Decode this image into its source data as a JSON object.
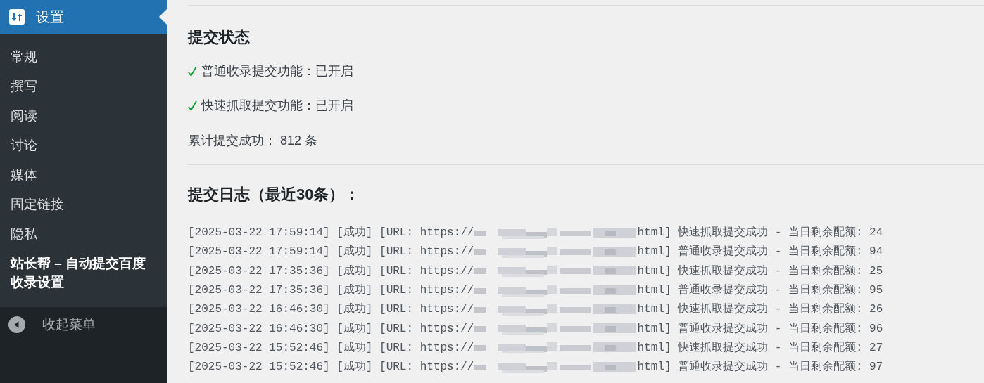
{
  "sidebar": {
    "header": {
      "label": "设置"
    },
    "items": [
      {
        "label": "常规",
        "selected": false
      },
      {
        "label": "撰写",
        "selected": false
      },
      {
        "label": "阅读",
        "selected": false
      },
      {
        "label": "讨论",
        "selected": false
      },
      {
        "label": "媒体",
        "selected": false
      },
      {
        "label": "固定链接",
        "selected": false
      },
      {
        "label": "隐私",
        "selected": false
      },
      {
        "label": "站长帮 – 自动提交百度收录设置",
        "selected": true
      }
    ],
    "collapse_label": "收起菜单"
  },
  "status": {
    "title": "提交状态",
    "features": [
      {
        "label": "普通收录提交功能：已开启"
      },
      {
        "label": "快速抓取提交功能：已开启"
      }
    ],
    "total": "累计提交成功： 812 条"
  },
  "log": {
    "title": "提交日志（最近30条）：",
    "entries": [
      {
        "before": "[2025-03-22 17:59:14] [成功] [URL: https://",
        "after": "html] 快速抓取提交成功 - 当日剩余配额: 24"
      },
      {
        "before": "[2025-03-22 17:59:14] [成功] [URL: https://",
        "after": "html] 普通收录提交成功 - 当日剩余配额: 94"
      },
      {
        "before": "[2025-03-22 17:35:36] [成功] [URL: https://",
        "after": "html] 快速抓取提交成功 - 当日剩余配额: 25"
      },
      {
        "before": "[2025-03-22 17:35:36] [成功] [URL: https://",
        "after": "html] 普通收录提交成功 - 当日剩余配额: 95"
      },
      {
        "before": "[2025-03-22 16:46:30] [成功] [URL: https://",
        "after": "html] 快速抓取提交成功 - 当日剩余配额: 26"
      },
      {
        "before": "[2025-03-22 16:46:30] [成功] [URL: https://",
        "after": "html] 普通收录提交成功 - 当日剩余配额: 96"
      },
      {
        "before": "[2025-03-22 15:52:46] [成功] [URL: https://",
        "after": "html] 快速抓取提交成功 - 当日剩余配额: 27"
      },
      {
        "before": "[2025-03-22 15:52:46] [成功] [URL: https://",
        "after": "html] 普通收录提交成功 - 当日剩余配额: 97"
      }
    ]
  }
}
